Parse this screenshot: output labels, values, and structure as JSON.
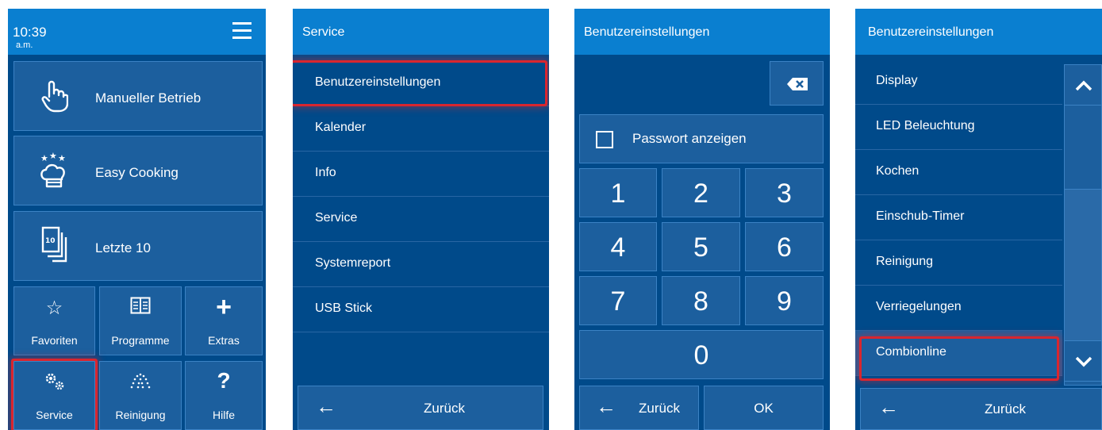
{
  "screen1": {
    "time": "10:39",
    "ampm": "a.m.",
    "menu_icon": "hamburger-icon",
    "tiles": [
      {
        "label": "Manueller Betrieb",
        "icon": "hand-pointer-icon"
      },
      {
        "label": "Easy Cooking",
        "icon": "chef-hat-icon"
      },
      {
        "label": "Letzte 10",
        "icon": "recent-cards-icon"
      }
    ],
    "small_tiles": [
      {
        "label": "Favoriten",
        "icon": "star-icon"
      },
      {
        "label": "Programme",
        "icon": "book-icon"
      },
      {
        "label": "Extras",
        "icon": "plus-icon"
      },
      {
        "label": "Service",
        "icon": "gears-icon"
      },
      {
        "label": "Reinigung",
        "icon": "spray-icon"
      },
      {
        "label": "Hilfe",
        "icon": "question-icon"
      }
    ]
  },
  "screen2": {
    "title": "Service",
    "items": [
      "Benutzereinstellungen",
      "Kalender",
      "Info",
      "Service",
      "Systemreport",
      "USB Stick"
    ],
    "back_label": "Zurück"
  },
  "screen3": {
    "title": "Benutzereinstellungen",
    "show_password_label": "Passwort anzeigen",
    "keys": [
      "1",
      "2",
      "3",
      "4",
      "5",
      "6",
      "7",
      "8",
      "9",
      "0"
    ],
    "back_label": "Zurück",
    "ok_label": "OK"
  },
  "screen4": {
    "title": "Benutzereinstellungen",
    "items": [
      "Display",
      "LED Beleuchtung",
      "Kochen",
      "Einschub-Timer",
      "Reinigung",
      "Verriegelungen",
      "Combionline"
    ],
    "back_label": "Zurück"
  },
  "colors": {
    "header": "#0a7fd0",
    "panel": "#004a8a",
    "tile": "#1c5f9e",
    "highlight": "#d9262f"
  }
}
